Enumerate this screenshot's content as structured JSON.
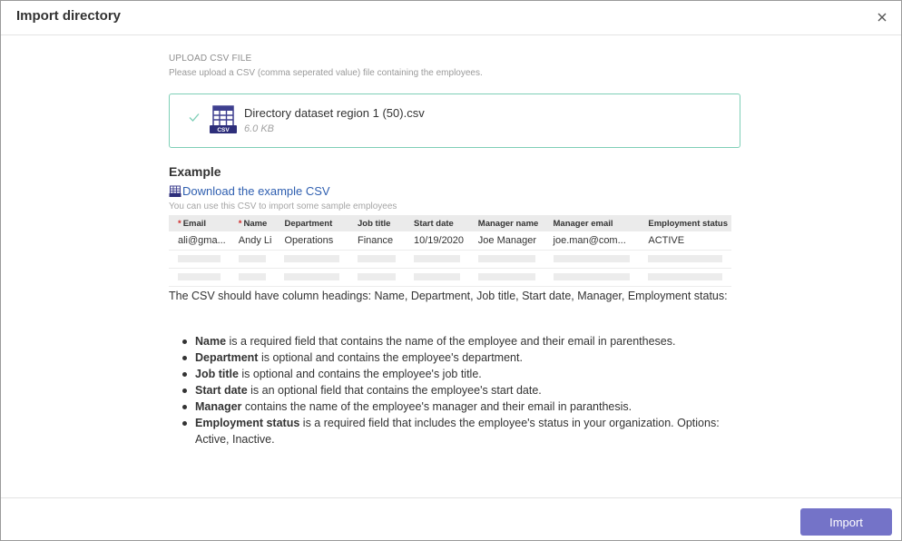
{
  "dialog": {
    "title": "Import directory"
  },
  "upload": {
    "label": "UPLOAD CSV FILE",
    "description": "Please upload a CSV (comma seperated value) file containing the employees.",
    "file_name": "Directory dataset region 1 (50).csv",
    "file_size": "6.0 KB",
    "file_icon_text": "CSV",
    "status_icon": "check-icon",
    "accent_color": "#7fcfb7"
  },
  "example": {
    "title": "Example",
    "download_label": "Download the example CSV",
    "hint": "You can use this CSV to import some sample employees",
    "required_marker": "*",
    "columns": [
      "Email",
      "Name",
      "Department",
      "Job title",
      "Start date",
      "Manager name",
      "Manager email",
      "Employment status"
    ],
    "row": [
      "ali@gma...",
      "Andy Li",
      "Operations",
      "Finance",
      "10/19/2020",
      "Joe Manager",
      "joe.man@com...",
      "ACTIVE"
    ]
  },
  "instructions": {
    "intro": "The CSV should have column headings: Name, Department, Job title, Start date, Manager, Employment status:",
    "fields": [
      {
        "name": "Name",
        "text": " is a required field that contains the name of the employee and their email in parentheses."
      },
      {
        "name": "Department",
        "text": " is optional and contains the employee's department."
      },
      {
        "name": "Job title",
        "text": " is optional and contains the employee's job title."
      },
      {
        "name": "Start date",
        "text": " is an optional field that contains the employee's start date."
      },
      {
        "name": "Manager",
        "text": " contains the name of the employee's manager and their email in paranthesis."
      },
      {
        "name": "Employment status",
        "text": " is a required field that includes the employee's status in your organization. Options: Active, Inactive."
      }
    ]
  },
  "footer": {
    "import_label": "Import",
    "button_color": "#7473c8"
  }
}
